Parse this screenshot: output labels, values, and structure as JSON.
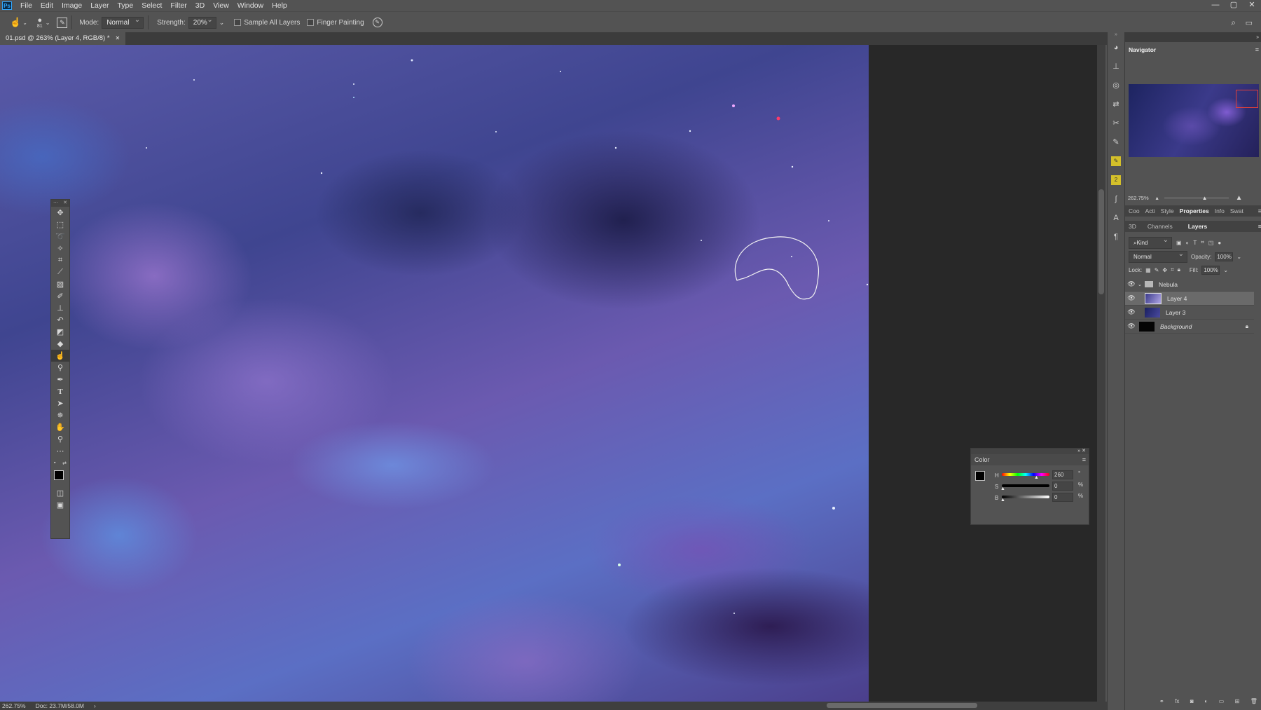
{
  "app": {
    "logo": "Ps"
  },
  "menu": [
    "File",
    "Edit",
    "Image",
    "Layer",
    "Type",
    "Select",
    "Filter",
    "3D",
    "View",
    "Window",
    "Help"
  ],
  "window_controls": [
    "—",
    "▢",
    "✕"
  ],
  "options": {
    "brush_size": "81",
    "mode_label": "Mode:",
    "mode_value": "Normal",
    "strength_label": "Strength:",
    "strength_value": "20%",
    "sample_all_layers": "Sample All Layers",
    "finger_painting": "Finger Painting"
  },
  "document_tab": {
    "title": "01.psd @ 263% (Layer 4, RGB/8) *",
    "close": "✕"
  },
  "status": {
    "zoom": "262.75%",
    "doc": "Doc: 23.7M/58.0M",
    "arrow": "›"
  },
  "navigator": {
    "title": "Navigator",
    "zoom": "262.75%"
  },
  "panel_tabs": [
    "Coo",
    "Acti",
    "Style",
    "Properties",
    "Info",
    "Swat"
  ],
  "panel_tabs_active": "Properties",
  "layers_tabs": [
    "3D",
    "Channels",
    "Layers"
  ],
  "layers_tabs_active": "Layers",
  "layers_panel": {
    "filter_kind": "Kind",
    "blend_mode": "Normal",
    "opacity_label": "Opacity:",
    "opacity_value": "100%",
    "lock_label": "Lock:",
    "fill_label": "Fill:",
    "fill_value": "100%",
    "layers": [
      {
        "name": "Nebula",
        "type": "group"
      },
      {
        "name": "Layer 4",
        "type": "layer",
        "selected": true
      },
      {
        "name": "Layer 3",
        "type": "layer"
      },
      {
        "name": "Background",
        "type": "background",
        "locked": true
      }
    ]
  },
  "color_panel": {
    "title": "Color",
    "h_label": "H",
    "h_value": "260",
    "h_unit": "°",
    "s_label": "S",
    "s_value": "0",
    "s_unit": "%",
    "b_label": "B",
    "b_value": "0",
    "b_unit": "%"
  },
  "tools": [
    "move-tool",
    "marquee-tool",
    "lasso-tool",
    "quick-select-tool",
    "crop-tool",
    "eyedropper-tool",
    "healing-brush-tool",
    "brush-tool",
    "clone-stamp-tool",
    "history-brush-tool",
    "eraser-tool",
    "paint-bucket-tool",
    "smudge-tool",
    "dodge-tool",
    "pen-tool",
    "type-tool",
    "path-select-tool",
    "shape-tool",
    "hand-tool",
    "zoom-tool",
    "more-tools"
  ]
}
